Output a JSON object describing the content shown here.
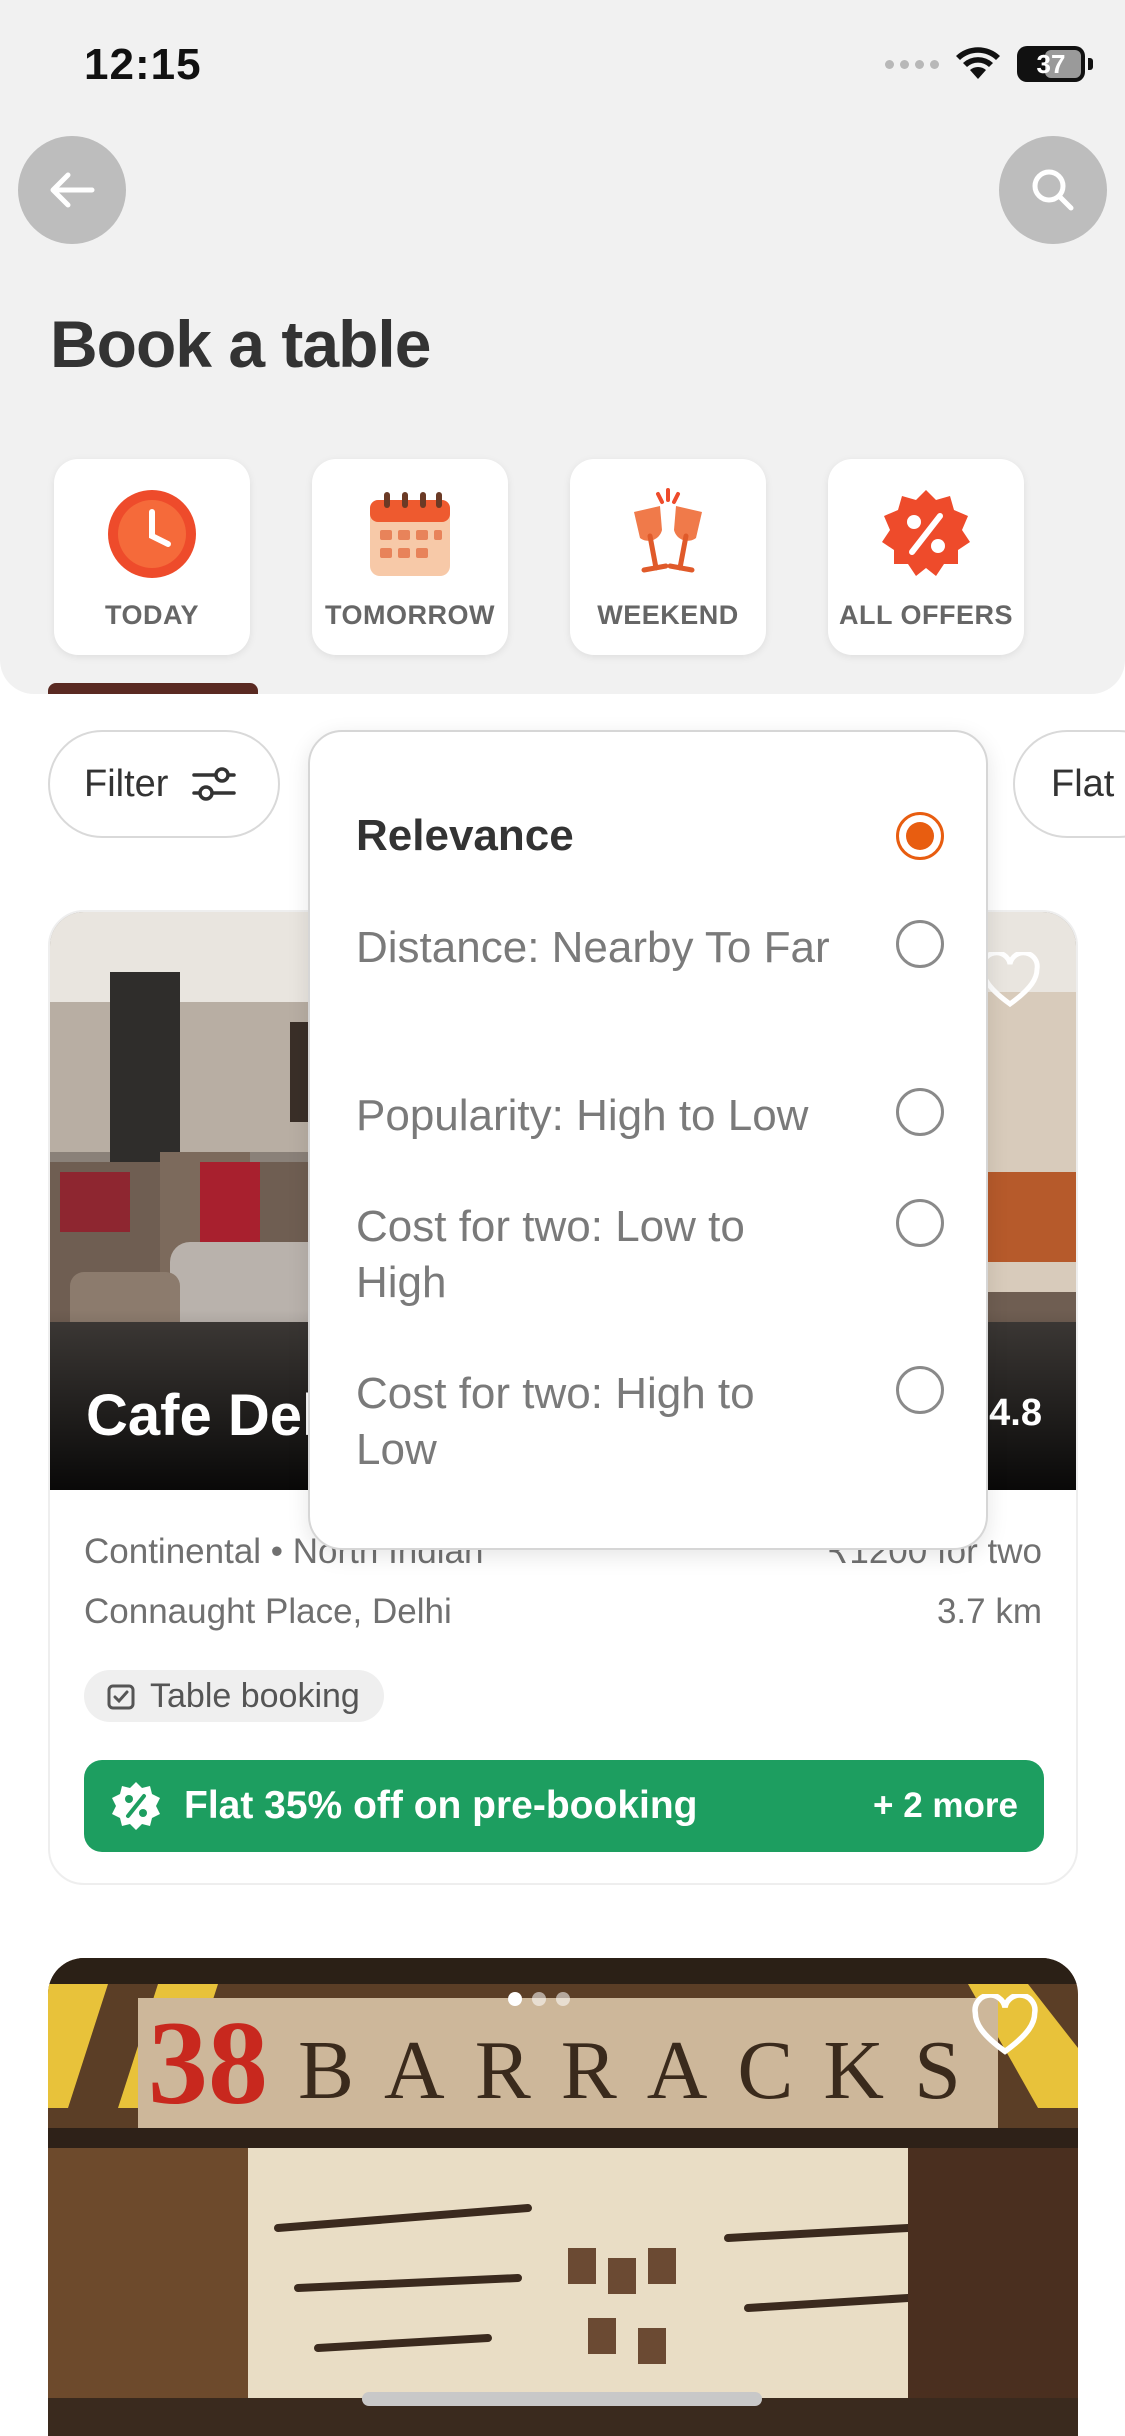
{
  "status_bar": {
    "time": "12:15",
    "battery": "37"
  },
  "header": {
    "title": "Book a table"
  },
  "date_chips": [
    {
      "label": "TODAY",
      "icon": "clock-icon"
    },
    {
      "label": "TOMORROW",
      "icon": "calendar-icon"
    },
    {
      "label": "WEEKEND",
      "icon": "cheers-icon"
    },
    {
      "label": "ALL OFFERS",
      "icon": "discount-icon"
    }
  ],
  "filters": {
    "filter_label": "Filter",
    "flat_label": "Flat"
  },
  "sort_menu": {
    "options": [
      {
        "label": "Relevance",
        "selected": true
      },
      {
        "label": "Distance: Nearby To Far",
        "selected": false
      },
      {
        "label": "Popularity: High to Low",
        "selected": false
      },
      {
        "label": "Cost for two: Low to High",
        "selected": false
      },
      {
        "label": "Cost for two: High to Low",
        "selected": false
      }
    ]
  },
  "restaurant_1": {
    "name": "Cafe Del",
    "rating": "4.8",
    "cuisine": "Continental • North Indian",
    "cost": "₹1200 for two",
    "location": "Connaught Place, Delhi",
    "distance": "3.7 km",
    "tag": "Table booking",
    "offer": "Flat 35% off on pre-booking",
    "offer_more": "+ 2 more"
  },
  "restaurant_2": {
    "sign_text": "38 BARRACKS"
  },
  "colors": {
    "accent": "#e85d10",
    "offer_green": "#1d9e60",
    "header_bg": "#f1f1f1"
  }
}
